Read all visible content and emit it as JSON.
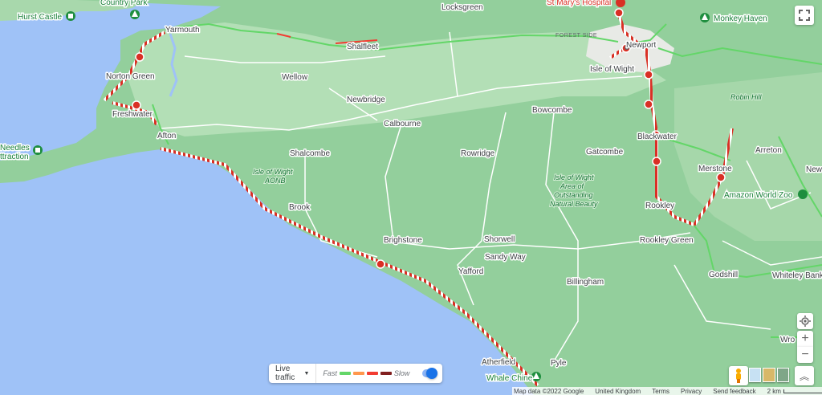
{
  "places": {
    "hurst_castle": "Hurst Castle",
    "country_park": "Country Park",
    "locksgreen": "Locksgreen",
    "st_marys": "St Mary's Hospital",
    "monkey_haven": "Monkey Haven",
    "yarmouth": "Yarmouth",
    "shalfleet": "Shalfleet",
    "forest_side": "FOREST SIDE",
    "newport": "Newport",
    "isle_of_wight": "Isle of Wight",
    "norton_green": "Norton Green",
    "wellow": "Wellow",
    "newbridge": "Newbridge",
    "robin_hill": "Robin Hill",
    "freshwater": "Freshwater",
    "bowcombe": "Bowcombe",
    "calbourne": "Calbourne",
    "needles_1": "Needles",
    "needles_2": "ttraction",
    "afton": "Afton",
    "blackwater": "Blackwater",
    "arreton": "Arreton",
    "shalcombe": "Shalcombe",
    "rowridge": "Rowridge",
    "gatcombe": "Gatcombe",
    "new": "New",
    "aonb_1": "Isle of Wight",
    "aonb_2": "AONB",
    "merstone": "Merstone",
    "outstanding_1": "Isle of Wight",
    "outstanding_2": "Area of",
    "outstanding_3": "Outstanding",
    "outstanding_4": "Natural Beauty",
    "amazon_zoo": "Amazon World Zoo",
    "brook": "Brook",
    "rookley": "Rookley",
    "rookley_green": "Rookley Green",
    "brighstone": "Brighstone",
    "shorwell": "Shorwell",
    "sandy_way": "Sandy Way",
    "yafford": "Yafford",
    "godshill": "Godshill",
    "whiteley_bank": "Whiteley Bank",
    "billingham": "Billingham",
    "wro": "Wro",
    "atherfield": "Atherfield",
    "pyle": "Pyle",
    "whale_chine": "Whale Chine"
  },
  "traffic_panel": {
    "toggle_label": "Live traffic",
    "fast": "Fast",
    "slow": "Slow",
    "enabled": true
  },
  "footer": {
    "map_data": "Map data ©2022 Google",
    "region": "United Kingdom",
    "terms": "Terms",
    "privacy": "Privacy",
    "feedback": "Send feedback",
    "scale": "2 km"
  },
  "colors": {
    "sea": "#9fc2f7",
    "land": "#93cf9c",
    "land_light": "#b3dfb6",
    "fast": "#63d668",
    "medium": "#ff974d",
    "slow": "#f23c32",
    "closure": "#d93025"
  },
  "icons": {
    "locate": "my-location-icon",
    "zoom_in": "plus-icon",
    "zoom_out": "minus-icon",
    "fullscreen": "fullscreen-icon",
    "pegman": "pegman-icon",
    "collapse": "chevron-up-double-icon"
  }
}
